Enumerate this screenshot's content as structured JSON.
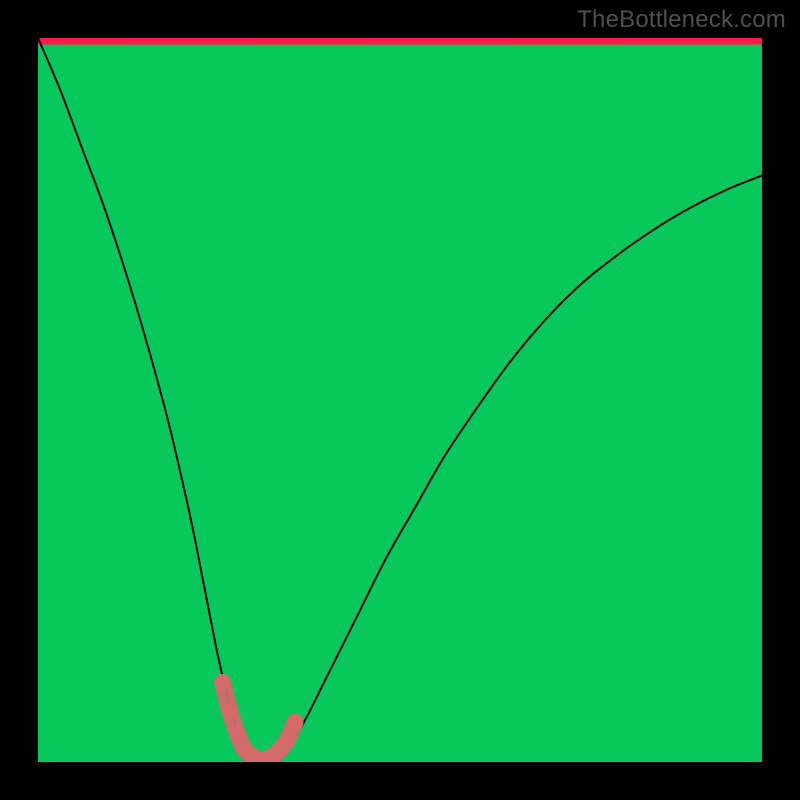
{
  "watermark": "TheBottleneck.com",
  "chart_data": {
    "type": "line",
    "title": "",
    "xlabel": "",
    "ylabel": "",
    "xlim": [
      0,
      100
    ],
    "ylim": [
      0,
      100
    ],
    "series": [
      {
        "name": "bottleneck-curve",
        "x": [
          0,
          3,
          6,
          9,
          12,
          15,
          18,
          21,
          23,
          25,
          27,
          29,
          30,
          31,
          32,
          33,
          34,
          35,
          37,
          40,
          44,
          48,
          52,
          56,
          60,
          65,
          70,
          75,
          80,
          85,
          90,
          95,
          100
        ],
        "y": [
          100,
          93,
          85,
          77,
          68,
          58,
          47,
          34,
          24,
          14,
          6,
          1.5,
          0.5,
          0.2,
          0.2,
          0.4,
          1.0,
          2.5,
          6,
          12,
          20,
          28,
          35,
          42,
          48,
          55,
          61,
          66,
          70,
          73.5,
          76.5,
          79,
          81
        ]
      }
    ],
    "highlight": {
      "name": "bottleneck-sweet-spot",
      "color": "#d46a6a",
      "x": [
        25.5,
        26.5,
        27.5,
        28.5,
        29.5,
        30.5,
        31.5,
        32.5,
        33.5,
        34.5,
        35.5
      ],
      "y": [
        11,
        7,
        4,
        1.8,
        0.9,
        0.3,
        0.4,
        0.9,
        1.8,
        3.2,
        5.5
      ]
    },
    "gradient_bands": [
      {
        "y": 99.1,
        "color": "#18d154"
      },
      {
        "y": 98.4,
        "color": "#34d94c"
      },
      {
        "y": 97.7,
        "color": "#55e146"
      },
      {
        "y": 97.0,
        "color": "#7ce93f"
      },
      {
        "y": 96.3,
        "color": "#a3ef38"
      },
      {
        "y": 95.6,
        "color": "#c8f431"
      },
      {
        "y": 94.7,
        "color": "#e5f72c"
      },
      {
        "y": 93.2,
        "color": "#f4f628"
      },
      {
        "y": 91.0,
        "color": "#fcf027"
      },
      {
        "y": 87.0,
        "color": "#ffe727"
      },
      {
        "y": 78.0,
        "color": "#ffda29"
      }
    ],
    "gradient_top_colors": [
      {
        "stop": 0.0,
        "color": "#ff1749"
      },
      {
        "stop": 0.18,
        "color": "#ff3a3e"
      },
      {
        "stop": 0.38,
        "color": "#ff6a34"
      },
      {
        "stop": 0.58,
        "color": "#ff9a2e"
      },
      {
        "stop": 0.78,
        "color": "#ffc52a"
      },
      {
        "stop": 1.0,
        "color": "#ffda29"
      }
    ]
  }
}
